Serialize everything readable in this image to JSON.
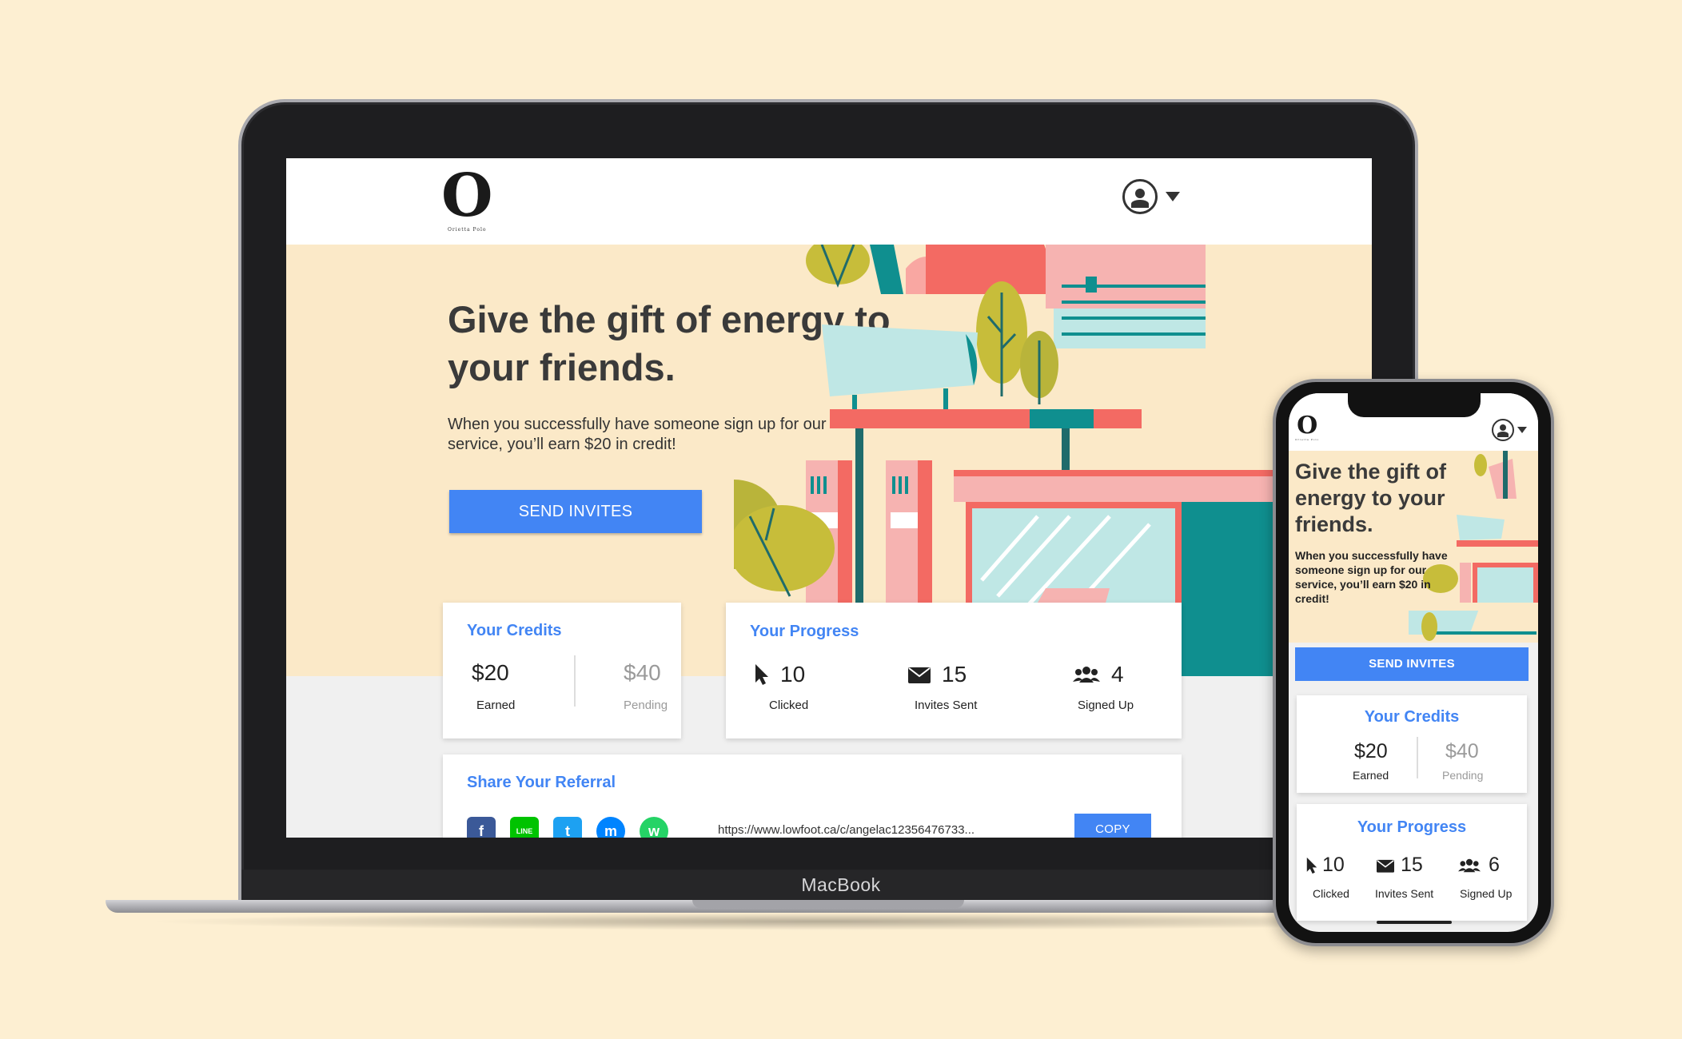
{
  "device": {
    "laptop_brand": "MacBook"
  },
  "brand": {
    "logo_letter": "O",
    "logo_subtitle": "Orietta Polo"
  },
  "hero": {
    "title": "Give the gift of energy to your friends.",
    "subtitle": "When you successfully have someone sign up for our service, you’ll earn $20 in credit!",
    "send_button": "SEND INVITES"
  },
  "credits": {
    "title": "Your Credits",
    "earned_amount": "$20",
    "earned_label": "Earned",
    "pending_amount": "$40",
    "pending_label": "Pending"
  },
  "progress": {
    "title": "Your Progress",
    "desktop": [
      {
        "icon": "cursor-icon",
        "value": "10",
        "label": "Clicked"
      },
      {
        "icon": "envelope-icon",
        "value": "15",
        "label": "Invites Sent"
      },
      {
        "icon": "users-icon",
        "value": "4",
        "label": "Signed Up"
      }
    ],
    "mobile": [
      {
        "icon": "cursor-icon",
        "value": "10",
        "label": "Clicked"
      },
      {
        "icon": "envelope-icon",
        "value": "15",
        "label": "Invites Sent"
      },
      {
        "icon": "users-icon",
        "value": "6",
        "label": "Signed Up"
      }
    ]
  },
  "share": {
    "title": "Share Your Referral",
    "networks": [
      {
        "icon": "facebook-icon",
        "glyph": "f",
        "color": "#3b5998"
      },
      {
        "icon": "line-icon",
        "glyph": "LINE",
        "color": "#00c300"
      },
      {
        "icon": "twitter-icon",
        "glyph": "t",
        "color": "#1da1f2"
      },
      {
        "icon": "messenger-icon",
        "glyph": "m",
        "color": "#0084ff"
      },
      {
        "icon": "whatsapp-icon",
        "glyph": "w",
        "color": "#25d366"
      }
    ],
    "link": "https://www.lowfoot.ca/c/angelac12356476733...",
    "copy_button": "COPY"
  },
  "colors": {
    "accent": "#4285f4",
    "background": "#fdefd2",
    "hero": "#fbe9c8"
  }
}
